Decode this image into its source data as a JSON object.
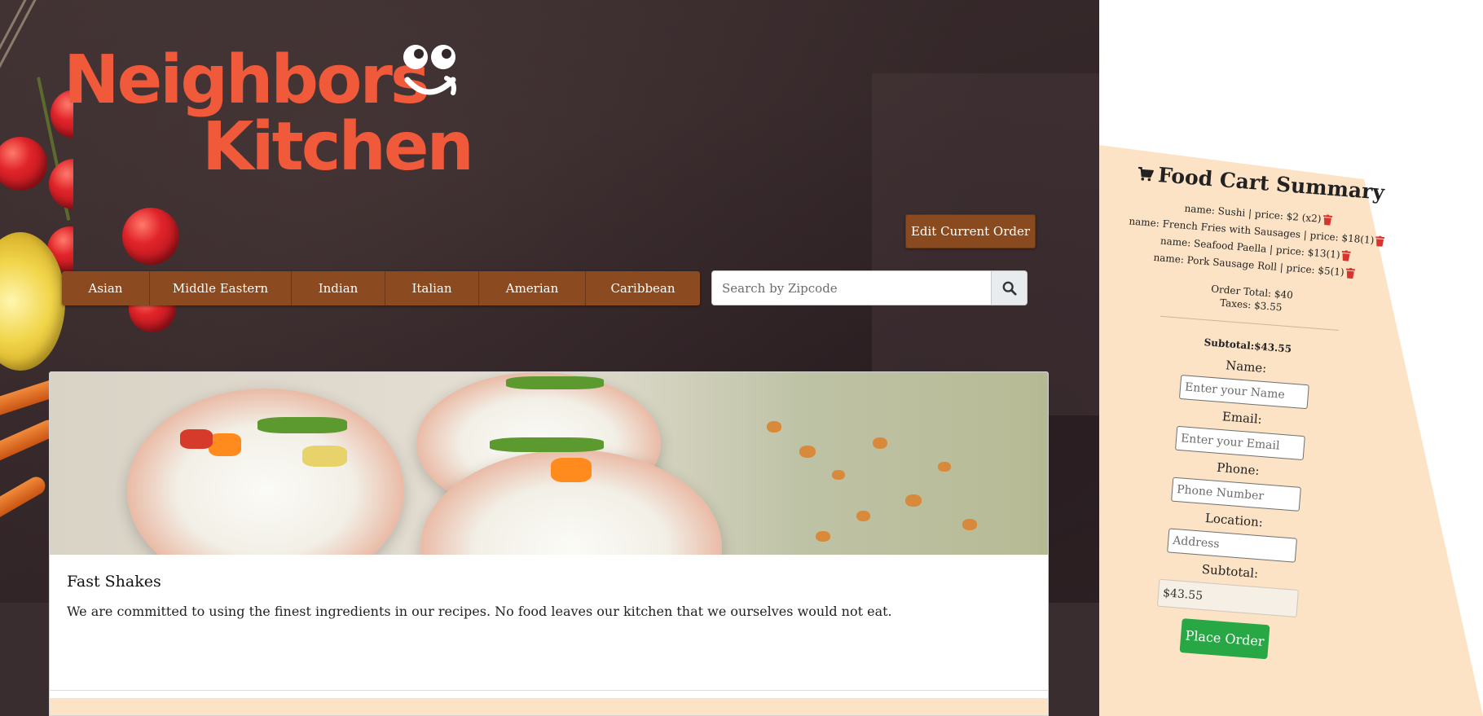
{
  "logo": {
    "line1": "Neighbors",
    "line2": "Kitchen",
    "face_icon": "smiley-face-icon",
    "color": "#f05a3a"
  },
  "edit_order_label": "Edit Current Order",
  "cuisines": [
    "Asian",
    "Middle Eastern",
    "Indian",
    "Italian",
    "Amerian",
    "Caribbean"
  ],
  "search": {
    "placeholder": "Search by Zipcode",
    "icon": "search-icon"
  },
  "card": {
    "title": "Fast Shakes",
    "text": "We are committed to using the finest ingredients in our recipes. No food leaves our kitchen that we ourselves would not eat."
  },
  "cart": {
    "title": "Food Cart Summary",
    "cart_icon": "cart-icon",
    "items": [
      {
        "text": "name: Sushi | price: $2 (x2)"
      },
      {
        "text": "name: French Fries with Sausages | price: $18(1)"
      },
      {
        "text": "name: Seafood Paella | price: $13(1)"
      },
      {
        "text": "name: Pork Sausage Roll | price: $5(1)"
      }
    ],
    "order_total": "Order Total: $40",
    "taxes": "Taxes: $3.55",
    "subtotal_line": "Subtotal:$43.55",
    "form": {
      "name_label": "Name:",
      "name_placeholder": "Enter your Name",
      "email_label": "Email:",
      "email_placeholder": "Enter your Email",
      "phone_label": "Phone:",
      "phone_placeholder": "Phone Number",
      "location_label": "Location:",
      "location_placeholder": "Address",
      "subtotal_label": "Subtotal:",
      "subtotal_value": "$43.55"
    },
    "place_order_label": "Place Order"
  },
  "colors": {
    "brown_button": "#8b4a1f",
    "cart_bg": "#fde3c6",
    "place_order_green": "#28a745",
    "trash_red": "#d9332e"
  }
}
